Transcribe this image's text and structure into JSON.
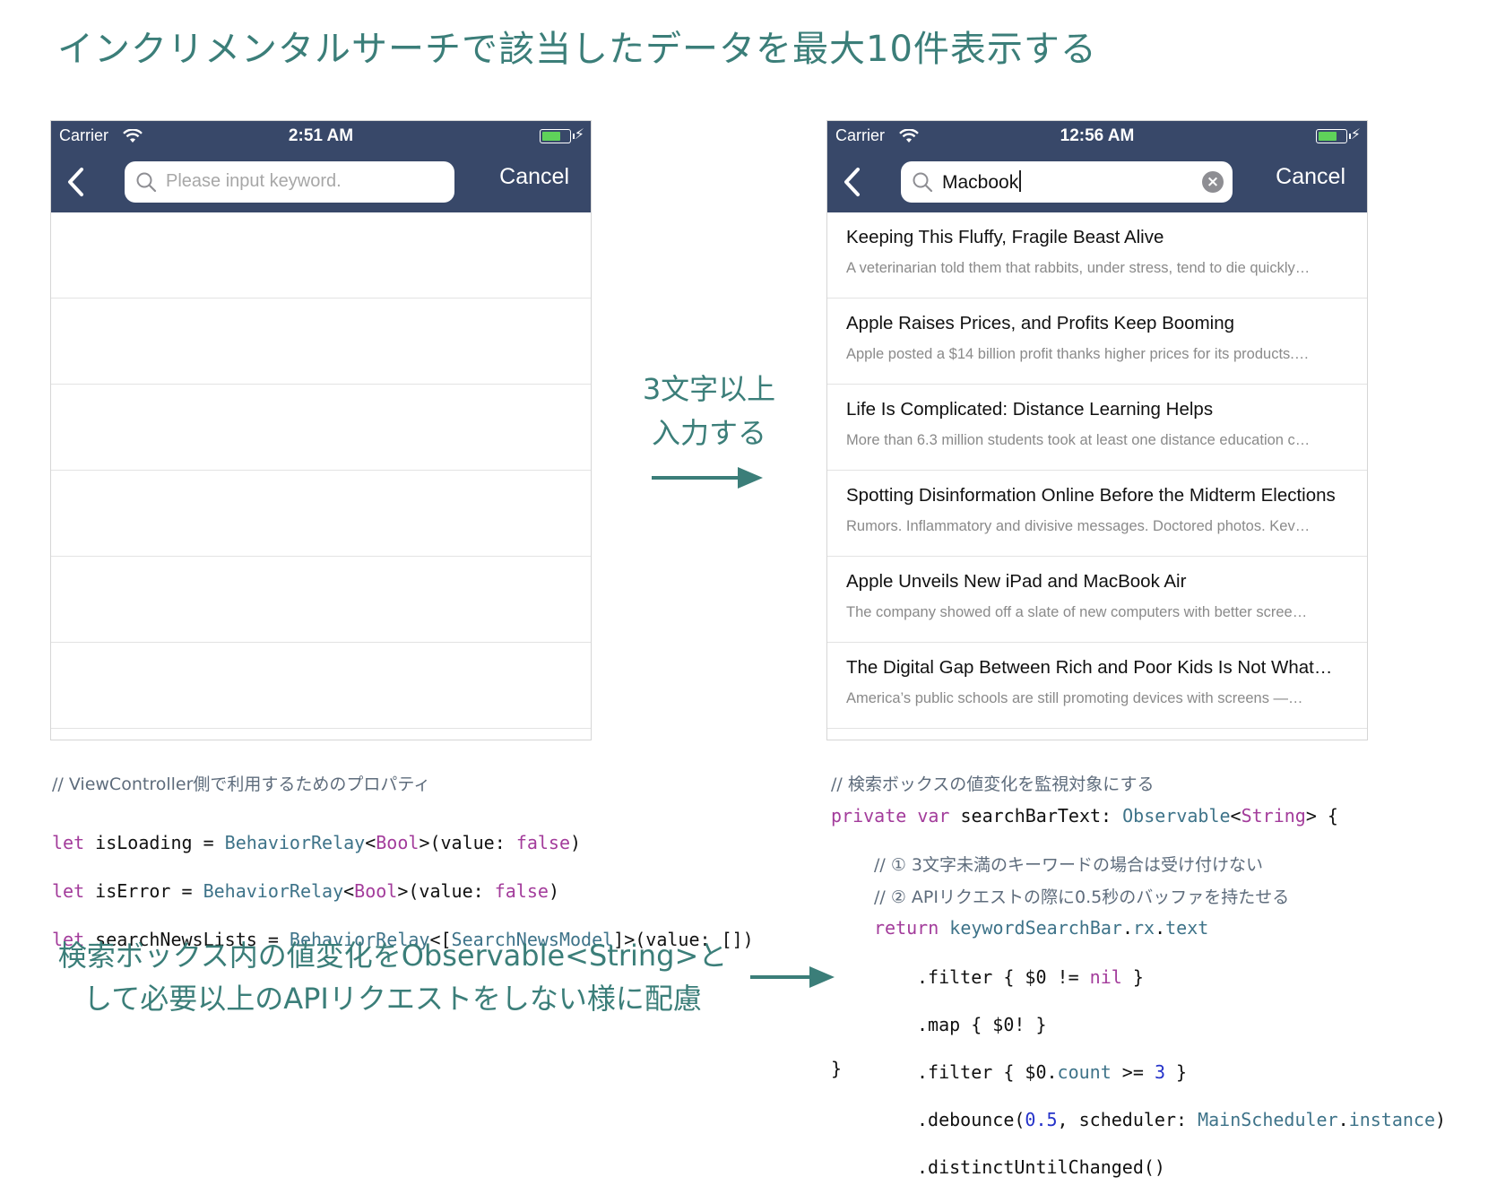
{
  "page_title": "インクリメンタルサーチで該当したデータを最大10件表示する",
  "left_phone": {
    "carrier": "Carrier",
    "time": "2:51 AM",
    "search_placeholder": "Please input keyword.",
    "cancel_label": "Cancel",
    "empty_row_count": 6
  },
  "right_phone": {
    "carrier": "Carrier",
    "time": "12:56 AM",
    "search_value": "Macbook",
    "cancel_label": "Cancel",
    "results": [
      {
        "title": "Keeping This Fluffy, Fragile Beast Alive",
        "subtitle": "A veterinarian told them that rabbits, under stress, tend to die quickly…"
      },
      {
        "title": "Apple Raises Prices, and Profits Keep Booming",
        "subtitle": "Apple posted a $14 billion profit thanks higher prices for its products.…"
      },
      {
        "title": "Life Is Complicated: Distance Learning Helps",
        "subtitle": "More than 6.3 million students took at least one distance education c…"
      },
      {
        "title": "Spotting Disinformation Online Before the Midterm Elections",
        "subtitle": "Rumors. Inflammatory and divisive messages. Doctored photos. Kev…"
      },
      {
        "title": "Apple Unveils New iPad and MacBook Air",
        "subtitle": "The company showed off a slate of new computers with better scree…"
      },
      {
        "title": "The Digital Gap Between Rich and Poor Kids Is Not What…",
        "subtitle": "America’s public schools are still promoting devices with screens —…"
      }
    ]
  },
  "middle_label": {
    "line1": "3文字以上",
    "line2": "入力する"
  },
  "code_left": {
    "comment": "// ViewController側で利用するためのプロパティ",
    "l1": {
      "kw": "let",
      "name": " isLoading = ",
      "type": "BehaviorRelay",
      "open": "<",
      "generic": "Bool",
      "rest": ">(value: ",
      "val": "false",
      "end": ")"
    },
    "l2": {
      "kw": "let",
      "name": " isError = ",
      "type": "BehaviorRelay",
      "open": "<",
      "generic": "Bool",
      "rest": ">(value: ",
      "val": "false",
      "end": ")"
    },
    "l3": {
      "kw": "let",
      "name": " searchNewsLists = ",
      "type": "BehaviorRelay",
      "open": "<[",
      "generic": "SearchNewsModel",
      "rest": "]>(value: [])"
    }
  },
  "code_right": {
    "comment": "// 検索ボックスの値変化を監視対象にする",
    "decl": {
      "kw1": "private",
      "kw2": "var",
      "name": " searchBarText: ",
      "type": "Observable",
      "open": "<",
      "generic": "String",
      "rest": "> {"
    },
    "comment1": "// ① 3文字未満のキーワードの場合は受け付けない",
    "comment2": "// ② APIリクエストの際に0.5秒のバッファを持たせる",
    "ret": {
      "kw": "return",
      "obj": " keywordSearchBar",
      "dot1": ".",
      "rx": "rx",
      "dot2": ".",
      "prop": "text"
    },
    "f1": {
      "a": ".filter { $0 != ",
      "nil": "nil",
      "b": " }"
    },
    "f2": ".map { $0! }",
    "f3": {
      "a": ".filter { $0.",
      "count": "count",
      "b": " >= ",
      "num": "3",
      "c": " }"
    },
    "f4": {
      "a": ".debounce(",
      "num": "0.5",
      "b": ", scheduler: ",
      "type": "MainScheduler",
      "dot": ".",
      "inst": "instance",
      "c": ")"
    },
    "f5": ".distinctUntilChanged()",
    "close": "}"
  },
  "bottom_note": {
    "line1": "検索ボックス内の値変化をObservable<String>と",
    "line2": "して必要以上のAPIリクエストをしない様に配慮"
  },
  "colors": {
    "navbar": "#384869",
    "accent_teal": "#3b7e79",
    "keyword": "#a33c9b",
    "type": "#3e7389",
    "number": "#2432c9",
    "battery": "#5fd25a"
  }
}
